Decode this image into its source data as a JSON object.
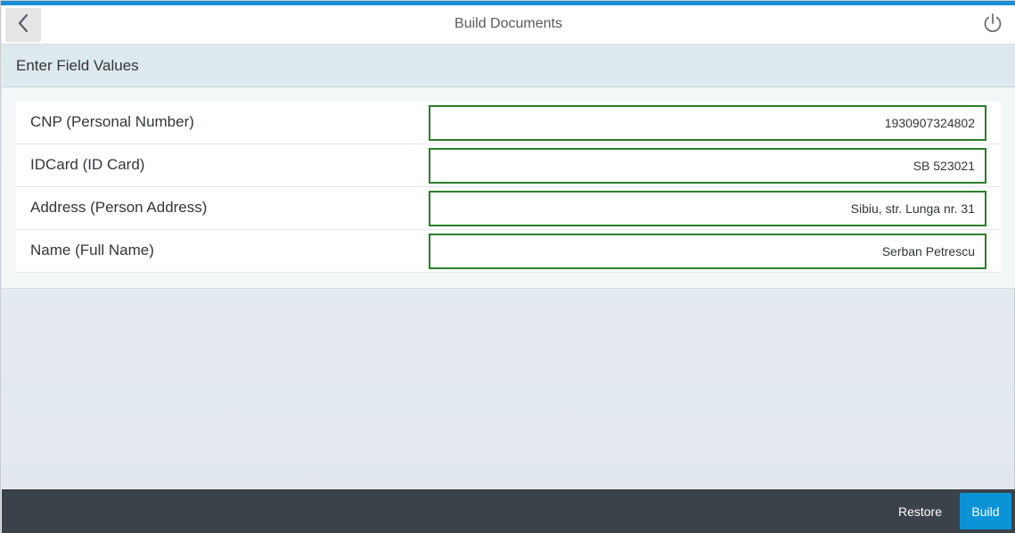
{
  "header": {
    "title": "Build Documents",
    "back_icon": "chevron-left-icon",
    "power_icon": "power-icon"
  },
  "subheader": {
    "title": "Enter Field Values"
  },
  "fields": [
    {
      "label": "CNP (Personal Number)",
      "value": "1930907324802"
    },
    {
      "label": "IDCard (ID Card)",
      "value": "SB 523021"
    },
    {
      "label": "Address (Person Address)",
      "value": "Sibiu, str. Lunga nr. 31"
    },
    {
      "label": "Name (Full Name)",
      "value": "Serban Petrescu"
    }
  ],
  "footer": {
    "restore_label": "Restore",
    "build_label": "Build"
  },
  "colors": {
    "accent": "#1b8dd6",
    "input_border": "#2b7d2b",
    "footer_bg": "#3c4249",
    "primary_button": "#0a93d7"
  }
}
